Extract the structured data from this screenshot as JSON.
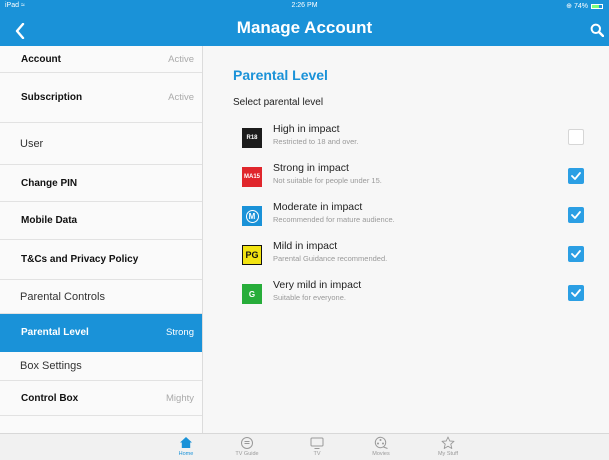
{
  "status_bar": {
    "device": "iPad ≈",
    "time": "2:26 PM",
    "battery": "⊕ 74%"
  },
  "header": {
    "title": "Manage Account"
  },
  "sidebar": {
    "items": [
      {
        "label": "Account",
        "value": "Active",
        "kind": "item",
        "selected": false
      },
      {
        "label": "Subscription",
        "value": "Active",
        "kind": "item",
        "selected": false
      },
      {
        "label": "User",
        "value": "",
        "kind": "section",
        "selected": false
      },
      {
        "label": "Change PIN",
        "value": "",
        "kind": "item",
        "selected": false
      },
      {
        "label": "Mobile Data",
        "value": "",
        "kind": "item",
        "selected": false
      },
      {
        "label": "T&Cs and Privacy Policy",
        "value": "",
        "kind": "item",
        "selected": false
      },
      {
        "label": "Parental Controls",
        "value": "",
        "kind": "section",
        "selected": false
      },
      {
        "label": "Parental Level",
        "value": "Strong",
        "kind": "item",
        "selected": true
      },
      {
        "label": "Box Settings",
        "value": "",
        "kind": "section",
        "selected": false
      },
      {
        "label": "Control Box",
        "value": "Mighty",
        "kind": "item",
        "selected": false
      }
    ]
  },
  "main": {
    "title": "Parental Level",
    "subtitle": "Select parental level",
    "levels": [
      {
        "name": "High in impact",
        "desc": "Restricted to 18 and over.",
        "badge_text": "R18",
        "badge_icon": "r18-rating-icon",
        "checked": false
      },
      {
        "name": "Strong in impact",
        "desc": "Not suitable for people under 15.",
        "badge_text": "MA15",
        "badge_icon": "ma15-rating-icon",
        "checked": true
      },
      {
        "name": "Moderate in impact",
        "desc": "Recommended for mature audience.",
        "badge_text": "M",
        "badge_icon": "m-rating-icon",
        "checked": true
      },
      {
        "name": "Mild in impact",
        "desc": "Parental Guidance recommended.",
        "badge_text": "PG",
        "badge_icon": "pg-rating-icon",
        "checked": true
      },
      {
        "name": "Very mild in impact",
        "desc": "Suitable for everyone.",
        "badge_text": "G",
        "badge_icon": "g-rating-icon",
        "checked": true
      }
    ]
  },
  "tabbar": {
    "tabs": [
      {
        "label": "Home",
        "icon": "home-icon",
        "active": true
      },
      {
        "label": "TV Guide",
        "icon": "tv-guide-icon",
        "active": false
      },
      {
        "label": "TV",
        "icon": "tv-icon",
        "active": false
      },
      {
        "label": "Movies",
        "icon": "movies-icon",
        "active": false
      },
      {
        "label": "My Stuff",
        "icon": "star-icon",
        "active": false
      }
    ]
  },
  "colors": {
    "accent": "#1a92d8",
    "checkbox": "#2b9fe4",
    "background": "#f7f7f7"
  }
}
